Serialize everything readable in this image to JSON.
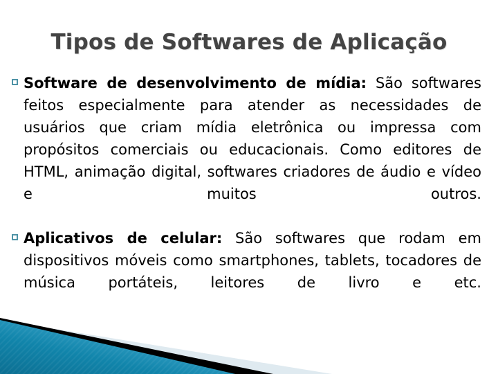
{
  "slide": {
    "title": "Tipos de Softwares de Aplicação",
    "background_color": "#ffffff",
    "title_color": "#444444",
    "body_color": "#000000",
    "bullet_color": "#4f93a6",
    "bullets": [
      {
        "lead": "Software de desenvolvimento de mídia:",
        "text": " São softwares feitos especialmente para atender as necessidades de usuários que criam mídia eletrônica ou impressa com propósitos comerciais ou educacionais. Como editores de HTML, animação digital, softwares criadores de áudio e vídeo e muitos outros."
      },
      {
        "lead": "Aplicativos de celular:",
        "text": " São softwares que rodam em dispositivos móveis como smartphones, tablets, tocadores de música portáteis, leitores de livro e etc."
      }
    ]
  },
  "decoration": {
    "name": "diagonal-corner-banner",
    "teal_dark": "#0d7ba0",
    "teal_light": "#4fb2d6",
    "stripe_color": "#000000",
    "pale_color": "#dfeaf0"
  }
}
